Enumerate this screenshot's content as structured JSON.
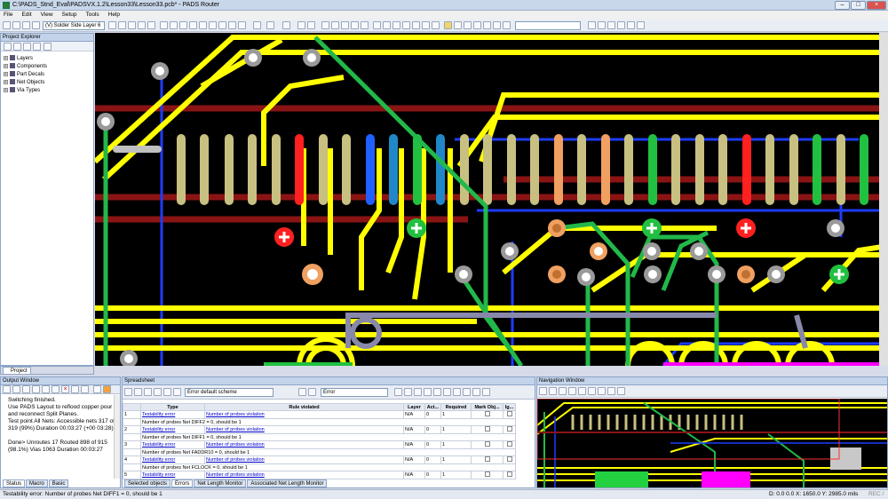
{
  "window": {
    "title": "C:\\PADS_Stnd_Eval\\PADSVX.1.2\\Lesson33\\Lesson33.pcb* - PADS Router"
  },
  "menu": [
    "File",
    "Edit",
    "View",
    "Setup",
    "Tools",
    "Help"
  ],
  "toolbar": {
    "layer_combo": "(V) Solder Side Layer 6",
    "blank_combo": ""
  },
  "project_explorer": {
    "title": "Project Explorer",
    "items": [
      "Layers",
      "Components",
      "Part Decals",
      "Net Objects",
      "Via Types"
    ],
    "tab": "Project"
  },
  "output_window": {
    "title": "Output Window",
    "text": "Switching finished.\nUse PADS Layout to reflood copper pour and reconnect Split Planes.\nTest point All Nets: Accessible nets 317 of 319 (99%) Duration 00:03:27 (+00 03:28)\n\nDone> Unroutes 17 Routed 898 of 915 (98.1%) Vias 1063 Duration 00:03:27",
    "tabs": [
      "Status",
      "Macro",
      "Basic"
    ]
  },
  "spreadsheet": {
    "title": "Spreadsheet",
    "scheme_combo": "Error default scheme",
    "filter_combo": "Error",
    "columns": [
      "",
      "Type",
      "Rule violated",
      "Layer",
      "Act...",
      "Required",
      "Mark Obj...",
      "Ig..."
    ],
    "rows": [
      {
        "num": "1",
        "type": "Testability error",
        "rule": "Number of probes violation",
        "layer": "N/A",
        "actual": "0",
        "required": "1",
        "detail": "Number of probes Net DIFF2 = 0, should be 1"
      },
      {
        "num": "2",
        "type": "Testability error",
        "rule": "Number of probes violation",
        "layer": "N/A",
        "actual": "0",
        "required": "1",
        "detail": "Number of probes Net DIFF1 = 0, should be 1"
      },
      {
        "num": "3",
        "type": "Testability error",
        "rule": "Number of probes violation",
        "layer": "N/A",
        "actual": "0",
        "required": "1",
        "detail": "Number of probes Net FADDR10 = 0, should be 1"
      },
      {
        "num": "4",
        "type": "Testability error",
        "rule": "Number of probes violation",
        "layer": "N/A",
        "actual": "0",
        "required": "1",
        "detail": "Number of probes Net FCLOCK = 0, should be 1"
      },
      {
        "num": "5",
        "type": "Testability error",
        "rule": "Number of probes violation",
        "layer": "N/A",
        "actual": "0",
        "required": "1",
        "detail": ""
      }
    ],
    "tabs": [
      "Selected objects",
      "Errors",
      "Net Length Monitor",
      "Associated Net Length Monitor"
    ]
  },
  "navigation_window": {
    "title": "Navigation Window"
  },
  "status": {
    "message": "Testability error: Number of probes Net DIFF1 = 0, should be 1",
    "coords": "D: 0.0 0.0   X: 1650.0   Y: 2985.0   mils",
    "right": "REC / "
  },
  "colors": {
    "board_bg": "#000000",
    "trace_yellow": "#ffff00",
    "trace_green": "#22b84a",
    "trace_blue": "#2040ff",
    "trace_red": "#b81818",
    "pad_tan": "#c8c080"
  }
}
